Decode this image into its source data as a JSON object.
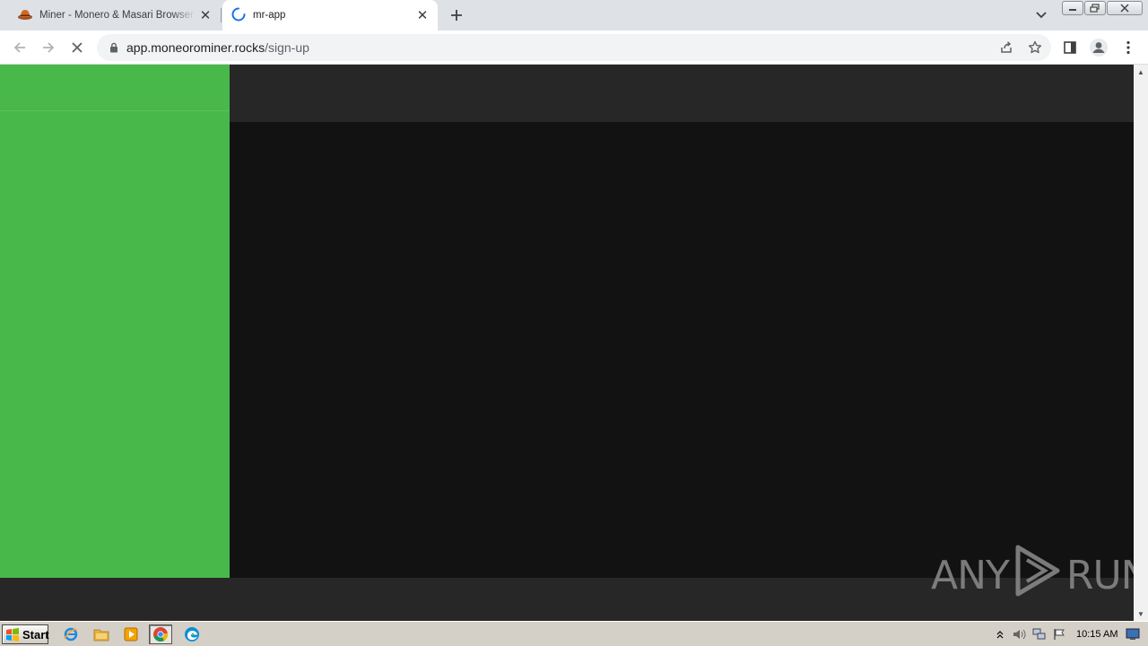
{
  "browser": {
    "tabs": [
      {
        "title": "Miner - Monero & Masari Browser Miner",
        "active": false
      },
      {
        "title": "mr-app",
        "active": true
      }
    ],
    "address": {
      "host": "app.moneorominer.rocks",
      "path": "/sign-up"
    }
  },
  "page": {
    "sidebar_color": "#49b84a",
    "topbar_color": "#272727",
    "main_color": "#121212"
  },
  "watermark": {
    "left": "ANY",
    "right": "RUN"
  },
  "taskbar": {
    "start_label": "Start",
    "clock": "10:15 AM"
  }
}
